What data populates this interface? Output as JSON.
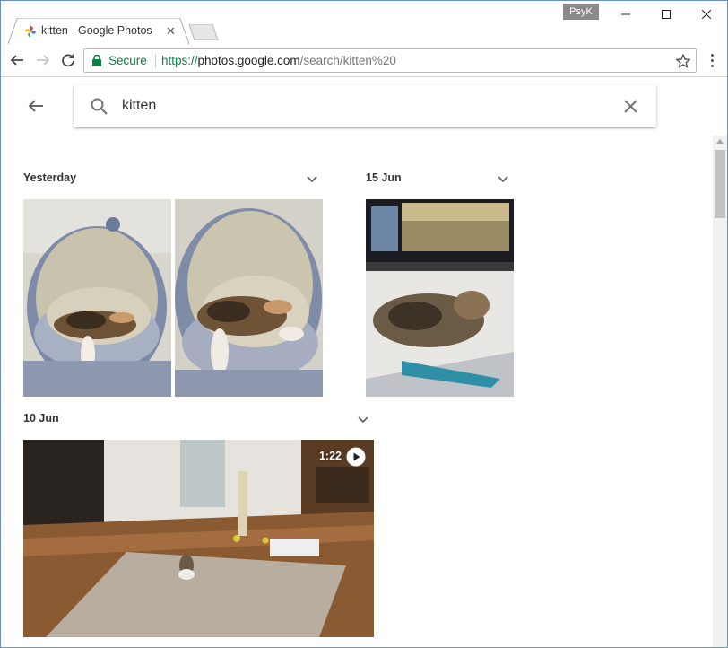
{
  "window": {
    "profile_name": "PsyK"
  },
  "tab": {
    "title": "kitten - Google Photos",
    "close_glyph": "✕"
  },
  "toolbar": {
    "secure_label": "Secure",
    "url_scheme": "https://",
    "url_host": "photos.google.com",
    "url_path": "/search/kitten%20"
  },
  "search": {
    "query": "kitten"
  },
  "groups": [
    {
      "label": "Yesterday",
      "photo_count": 2
    },
    {
      "label": "15 Jun",
      "photo_count": 1
    },
    {
      "label": "10 Jun",
      "photo_count": 1,
      "video_duration": "1:22"
    }
  ],
  "icons": {
    "back": "arrow-left-icon",
    "search": "search-icon",
    "clear": "close-icon",
    "play": "play-icon",
    "chevron": "chevron-down-icon",
    "star": "star-icon",
    "lock": "lock-icon"
  },
  "colors": {
    "secure_green": "#0b8043",
    "text_dark": "#333333",
    "accent_gray": "#757575"
  }
}
